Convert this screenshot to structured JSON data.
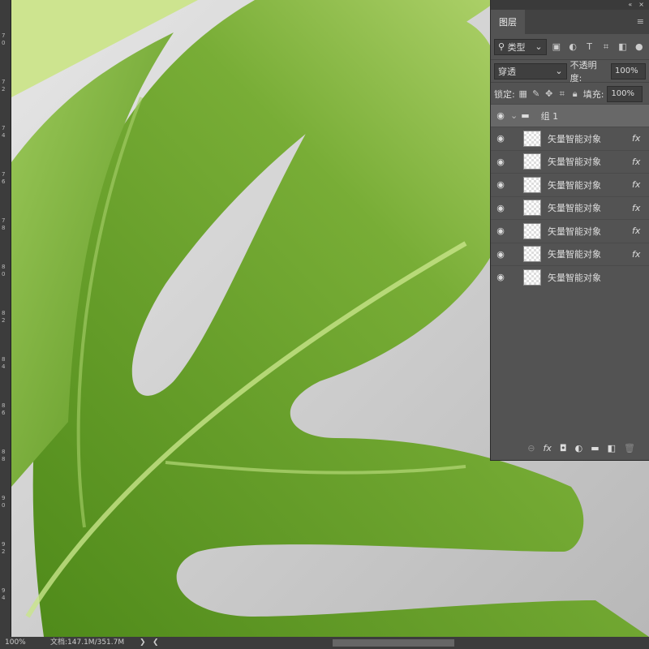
{
  "ruler": {
    "labels": [
      "70",
      "72",
      "74",
      "76",
      "78",
      "80",
      "82",
      "84",
      "86",
      "88",
      "90",
      "92",
      "94"
    ]
  },
  "panel": {
    "collapse_icon": "«",
    "close_icon": "×",
    "tab": "图层",
    "menu_icon": "≡",
    "filter": {
      "label": "类型",
      "icons": [
        "image",
        "adjust",
        "T",
        "shape",
        "smart"
      ]
    },
    "blend_mode": "穿透",
    "opacity_label": "不透明度:",
    "opacity": "100%",
    "lock_label": "锁定:",
    "fill_label": "填充:",
    "fill": "100%",
    "group": {
      "name": "组 1"
    },
    "layers": [
      {
        "name": "矢量智能对象",
        "fx": "fx"
      },
      {
        "name": "矢量智能对象",
        "fx": "fx"
      },
      {
        "name": "矢量智能对象",
        "fx": "fx"
      },
      {
        "name": "矢量智能对象",
        "fx": "fx"
      },
      {
        "name": "矢量智能对象",
        "fx": "fx"
      },
      {
        "name": "矢量智能对象",
        "fx": "fx"
      },
      {
        "name": "矢量智能对象",
        "fx": ""
      }
    ],
    "bottom": {
      "link": "⊖",
      "fx": "fx",
      "mask": "◘",
      "adjust": "◐",
      "folder": "▬",
      "new": "◧",
      "trash": "🗑"
    }
  },
  "status": {
    "zoom": "100%",
    "doc": "文档:147.1M/351.7M",
    "next": "❯",
    "prev": "❮"
  },
  "colors": {
    "leaf": "#6ea52e",
    "leaf_light": "#c8e58a",
    "bg": "#c9c9c9"
  }
}
